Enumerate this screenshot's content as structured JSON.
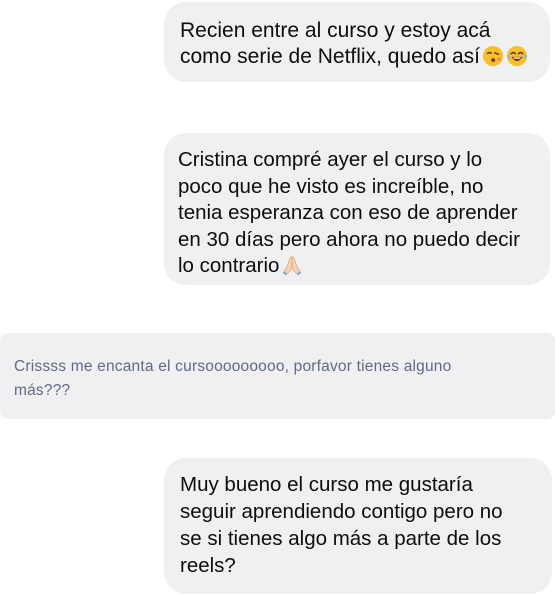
{
  "messages": [
    {
      "text": "Recien entre al curso y estoy acá\ncomo serie de Netflix, quedo así",
      "emojis": [
        "kissing-face-emoji",
        "laughing-tears-emoji"
      ]
    },
    {
      "text": "Cristina compré ayer el curso y lo\npoco que he visto es increíble, no\ntenia esperanza con eso de aprender\nen 30 días pero ahora no puedo decir\nlo contrario",
      "emojis": [
        "folded-hands-emoji"
      ]
    },
    {
      "text": "Crissss me encanta el cursooooooooo, porfavor tienes alguno\nmás???"
    },
    {
      "text": "Muy bueno el curso me gustaría\nseguir aprendiendo contigo pero no\nse si tienes algo más a parte de los\nreels?"
    }
  ],
  "colors": {
    "bubble_bg": "#f0f0f2",
    "text_primary": "#0d0d0d",
    "text_secondary": "#5f6a86"
  }
}
